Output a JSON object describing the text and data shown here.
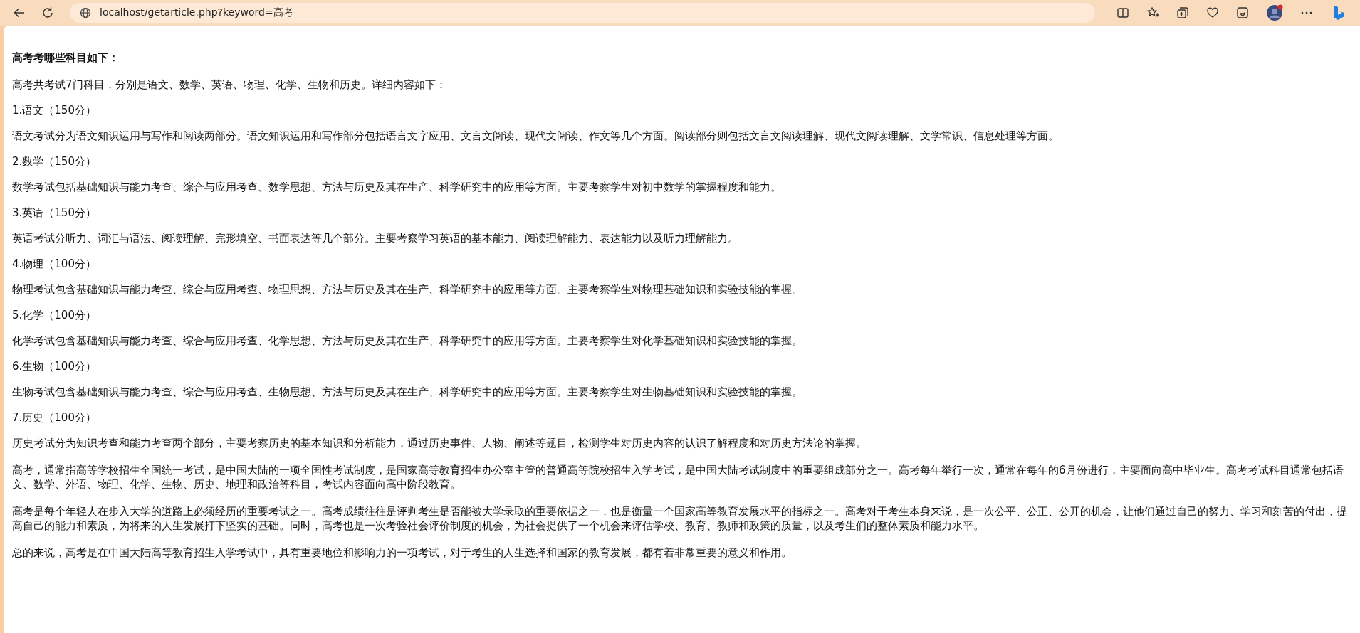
{
  "browser": {
    "url": "localhost/getarticle.php?keyword=高考"
  },
  "article": {
    "heading": "高考考哪些科目如下：",
    "paragraphs": [
      "高考共考试7门科目，分别是语文、数学、英语、物理、化学、生物和历史。详细内容如下：",
      "1.语文（150分）",
      "语文考试分为语文知识运用与写作和阅读两部分。语文知识运用和写作部分包括语言文字应用、文言文阅读、现代文阅读、作文等几个方面。阅读部分则包括文言文阅读理解、现代文阅读理解、文学常识、信息处理等方面。",
      "2.数学（150分）",
      "数学考试包括基础知识与能力考查、综合与应用考查、数学思想、方法与历史及其在生产、科学研究中的应用等方面。主要考察学生对初中数学的掌握程度和能力。",
      "3.英语（150分）",
      "英语考试分听力、词汇与语法、阅读理解、完形填空、书面表达等几个部分。主要考察学习英语的基本能力、阅读理解能力、表达能力以及听力理解能力。",
      "4.物理（100分）",
      "物理考试包含基础知识与能力考查、综合与应用考查、物理思想、方法与历史及其在生产、科学研究中的应用等方面。主要考察学生对物理基础知识和实验技能的掌握。",
      "5.化学（100分）",
      "化学考试包含基础知识与能力考查、综合与应用考查、化学思想、方法与历史及其在生产、科学研究中的应用等方面。主要考察学生对化学基础知识和实验技能的掌握。",
      "6.生物（100分）",
      "生物考试包含基础知识与能力考查、综合与应用考查、生物思想、方法与历史及其在生产、科学研究中的应用等方面。主要考察学生对生物基础知识和实验技能的掌握。",
      "7.历史（100分）",
      "历史考试分为知识考查和能力考查两个部分，主要考察历史的基本知识和分析能力，通过历史事件、人物、阐述等题目，检测学生对历史内容的认识了解程度和对历史方法论的掌握。"
    ],
    "closing": [
      "高考，通常指高等学校招生全国统一考试，是中国大陆的一项全国性考试制度，是国家高等教育招生办公室主管的普通高等院校招生入学考试，是中国大陆考试制度中的重要组成部分之一。高考每年举行一次，通常在每年的6月份进行，主要面向高中毕业生。高考考试科目通常包括语文、数学、外语、物理、化学、生物、历史、地理和政治等科目，考试内容面向高中阶段教育。",
      "高考是每个年轻人在步入大学的道路上必须经历的重要考试之一。高考成绩往往是评判考生是否能被大学录取的重要依据之一，也是衡量一个国家高等教育发展水平的指标之一。高考对于考生本身来说，是一次公平、公正、公开的机会，让他们通过自己的努力、学习和刻苦的付出，提高自己的能力和素质，为将来的人生发展打下坚实的基础。同时，高考也是一次考验社会评价制度的机会，为社会提供了一个机会来评估学校、教育、教师和政策的质量，以及考生们的整体素质和能力水平。",
      "总的来说，高考是在中国大陆高等教育招生入学考试中，具有重要地位和影响力的一项考试，对于考生的人生选择和国家的教育发展，都有着非常重要的意义和作用。"
    ]
  }
}
